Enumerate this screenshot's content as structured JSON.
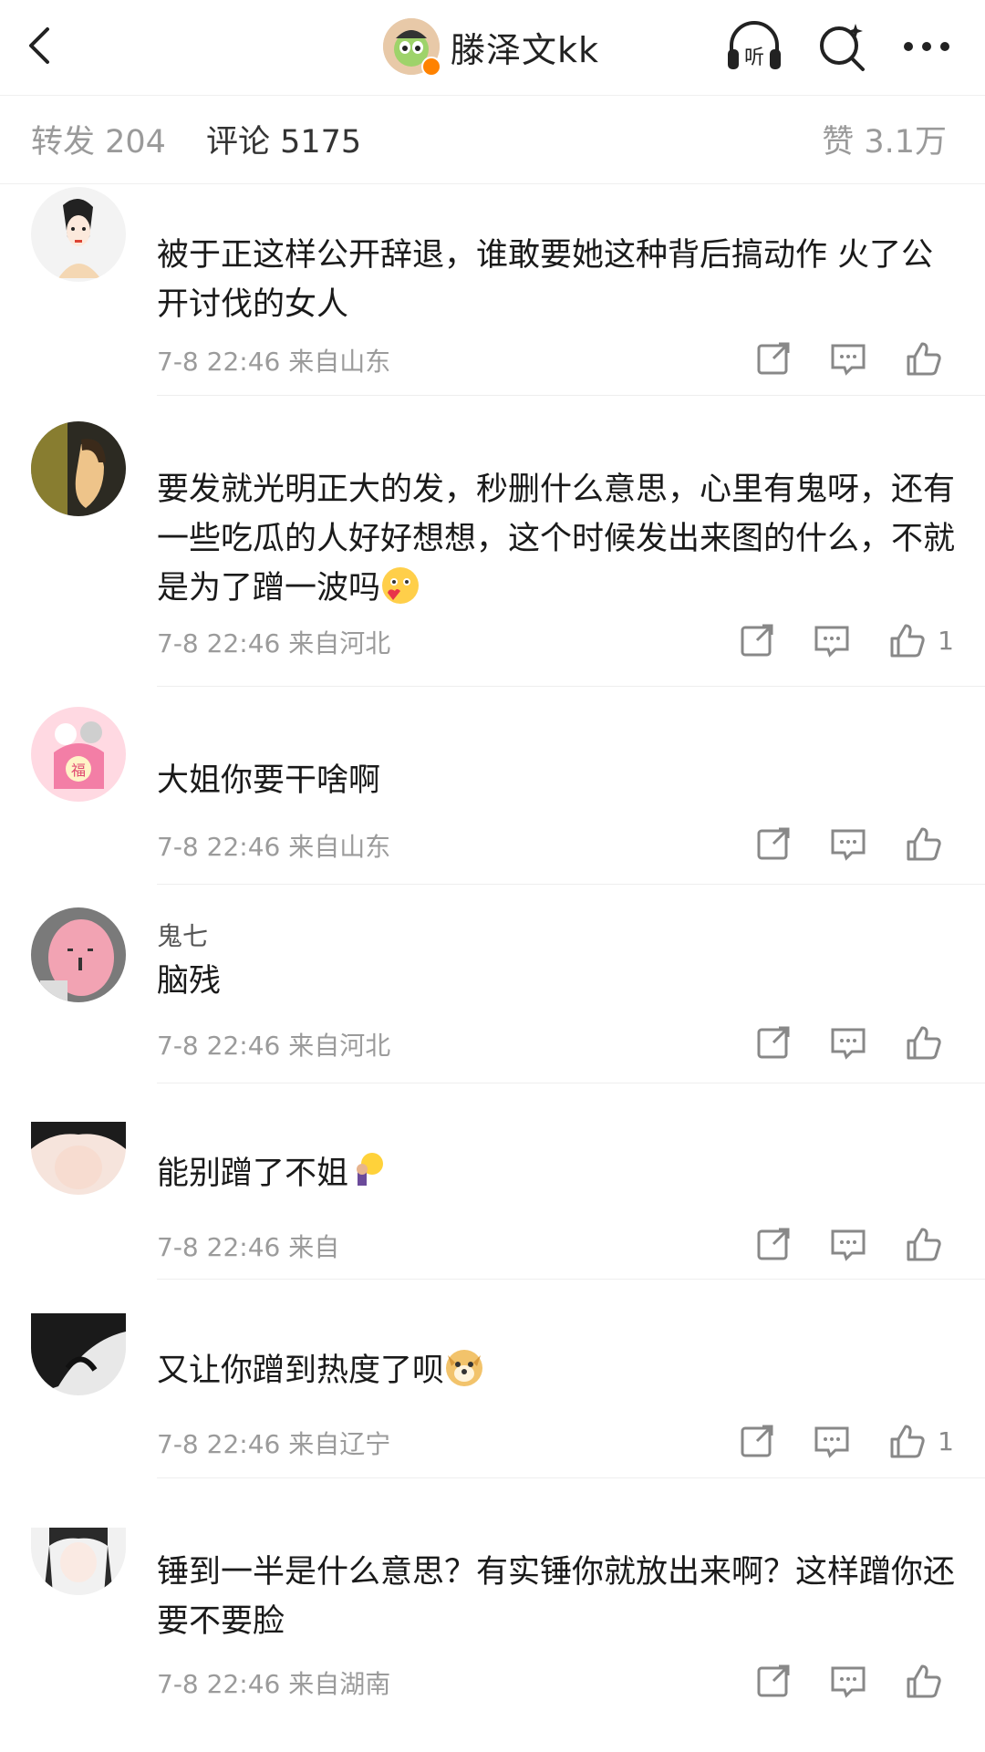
{
  "header": {
    "title": "滕泽文kk",
    "listen_icon": "headphones-icon",
    "search_icon": "search-icon",
    "more_icon": "more-icon"
  },
  "tabs": {
    "repost": "转发 204",
    "comment": "评论 5175",
    "like": "赞 3.1万"
  },
  "comments": [
    {
      "name": "",
      "text": "被于正这样公开辞退，谁敢要她这种背后搞动作   火了公开讨伐的女人",
      "time": "7-8 22:46",
      "location": "来自山东",
      "likes": ""
    },
    {
      "name": "",
      "text": "要发就光明正大的发，秒删什么意思，心里有鬼呀，还有一些吃瓜的人好好想想，这个时候发出来图的什么，不就是为了蹭一波吗",
      "time": "7-8 22:46",
      "location": "来自河北",
      "likes": "1"
    },
    {
      "name": "",
      "text": "大姐你要干啥啊",
      "time": "7-8 22:46",
      "location": "来自山东",
      "likes": ""
    },
    {
      "name": "鬼七",
      "text": "脑残",
      "time": "7-8 22:46",
      "location": "来自河北",
      "likes": ""
    },
    {
      "name": "",
      "text": "能别蹭了不姐",
      "time": "7-8 22:46",
      "location": "来自",
      "likes": ""
    },
    {
      "name": "",
      "text": "又让你蹭到热度了呗",
      "time": "7-8 22:46",
      "location": "来自辽宁",
      "likes": "1"
    },
    {
      "name": "",
      "text": "锤到一半是什么意思？有实锤你就放出来啊？这样蹭你还要不要脸",
      "time": "7-8 22:46",
      "location": "来自湖南",
      "likes": ""
    }
  ],
  "colors": {
    "text": "#1a1a1a",
    "meta": "#9b9b9b",
    "badge": "#ff8200"
  }
}
